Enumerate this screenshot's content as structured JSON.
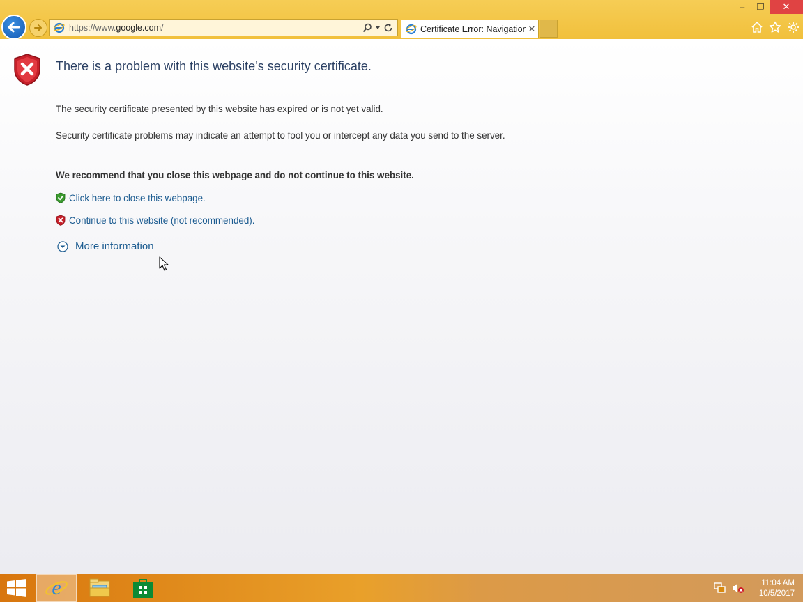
{
  "window": {
    "minimize": "–",
    "restore": "❐",
    "close": "✕"
  },
  "address_bar": {
    "url_prefix": "https://www.",
    "url_domain": "google.com",
    "url_suffix": "/"
  },
  "tab": {
    "title": "Certificate Error: Navigation...",
    "close": "✕"
  },
  "page": {
    "title": "There is a problem with this website’s security certificate.",
    "para1": "The security certificate presented by this website has expired or is not yet valid.",
    "para2": "Security certificate problems may indicate an attempt to fool you or intercept any data you send to the server.",
    "recommendation": "We recommend that you close this webpage and do not continue to this website.",
    "close_link": "Click here to close this webpage.",
    "continue_link": "Continue to this website (not recommended).",
    "more_info": "More information"
  },
  "taskbar": {
    "time": "11:04 AM",
    "date": "10/5/2017"
  },
  "colors": {
    "chrome": "#f1c03c",
    "link": "#1b5b90",
    "title": "#2a3f62",
    "error_red": "#d0212b",
    "safe_green": "#3c9a2f"
  }
}
